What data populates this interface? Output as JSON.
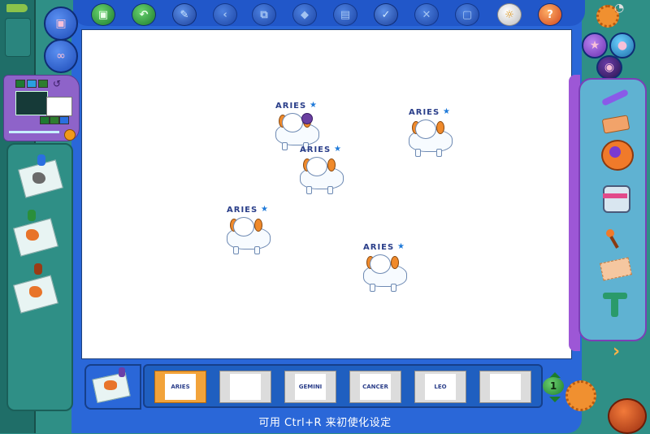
{
  "status_bar": {
    "hint": "可用 Ctrl+R 来初使化设定"
  },
  "canvas": {
    "stamps": [
      {
        "label": "ARIES"
      },
      {
        "label": "ARIES"
      },
      {
        "label": "ARIES"
      },
      {
        "label": "ARIES"
      },
      {
        "label": "ARIES"
      }
    ]
  },
  "stamp_tray": {
    "page": "1",
    "thumbnails": [
      {
        "label": "ARIES"
      },
      {
        "label": ""
      },
      {
        "label": "GEMINI"
      },
      {
        "label": "CANCER"
      },
      {
        "label": "LEO"
      },
      {
        "label": ""
      }
    ]
  },
  "toolbar": {
    "icons": [
      "save-icon",
      "undo-icon",
      "paint-icon",
      "back-icon",
      "copy-icon",
      "shapes-icon",
      "print-icon",
      "check-icon",
      "close-icon",
      "screen-icon",
      "bulb-icon",
      "help-icon"
    ]
  },
  "colors": {
    "frame": "#2a67d8",
    "canvas": "#ffffff",
    "side_panel": "#2f8f86",
    "accent_purple": "#8e63c9",
    "accent_orange": "#f29a1a"
  }
}
